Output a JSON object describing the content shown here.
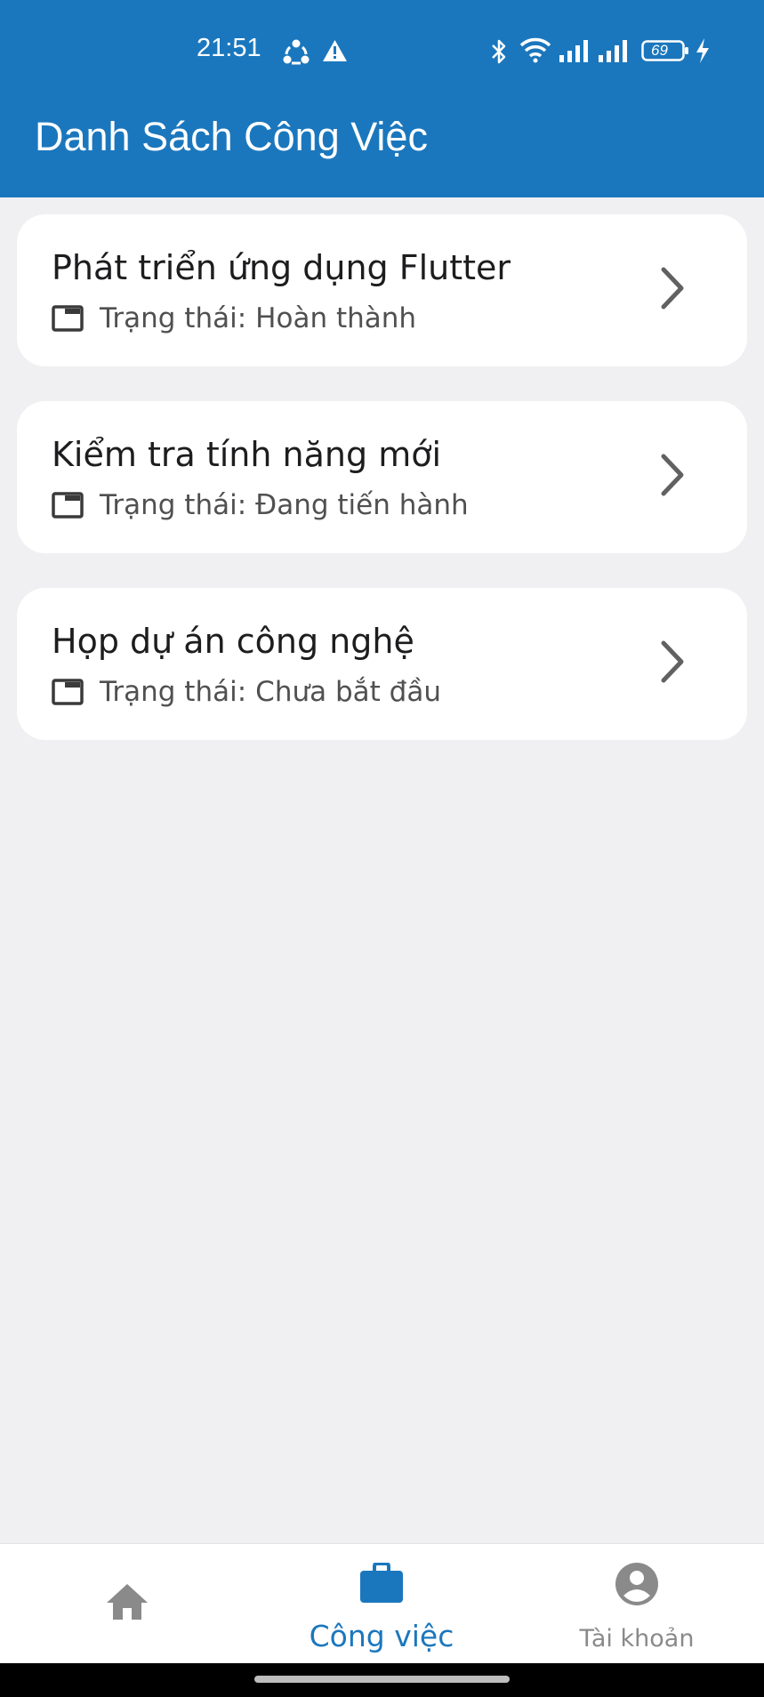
{
  "status_bar": {
    "time": "21:51",
    "battery_level": "69",
    "icons": [
      "sync-icon",
      "warning-icon",
      "bluetooth-icon",
      "wifi-icon",
      "signal-1-icon",
      "signal-2-icon",
      "battery-icon",
      "charging-icon"
    ]
  },
  "app_bar": {
    "title": "Danh Sách Công Việc",
    "background_color": "#1b77bd"
  },
  "tasks": [
    {
      "title": "Phát triển ứng dụng Flutter",
      "status_label": "Trạng thái:",
      "status_value": "Hoàn thành"
    },
    {
      "title": "Kiểm tra tính năng mới",
      "status_label": "Trạng thái:",
      "status_value": "Đang tiến hành"
    },
    {
      "title": "Họp dự án công nghệ",
      "status_label": "Trạng thái:",
      "status_value": "Chưa bắt đầu"
    }
  ],
  "bottom_nav": {
    "items": [
      {
        "label": "",
        "icon": "home-icon",
        "active": false
      },
      {
        "label": "Công việc",
        "icon": "briefcase-icon",
        "active": true
      },
      {
        "label": "Tài khoản",
        "icon": "account-circle-icon",
        "active": false
      }
    ],
    "active_color": "#1b77bd",
    "inactive_color": "#8a8a8a"
  }
}
